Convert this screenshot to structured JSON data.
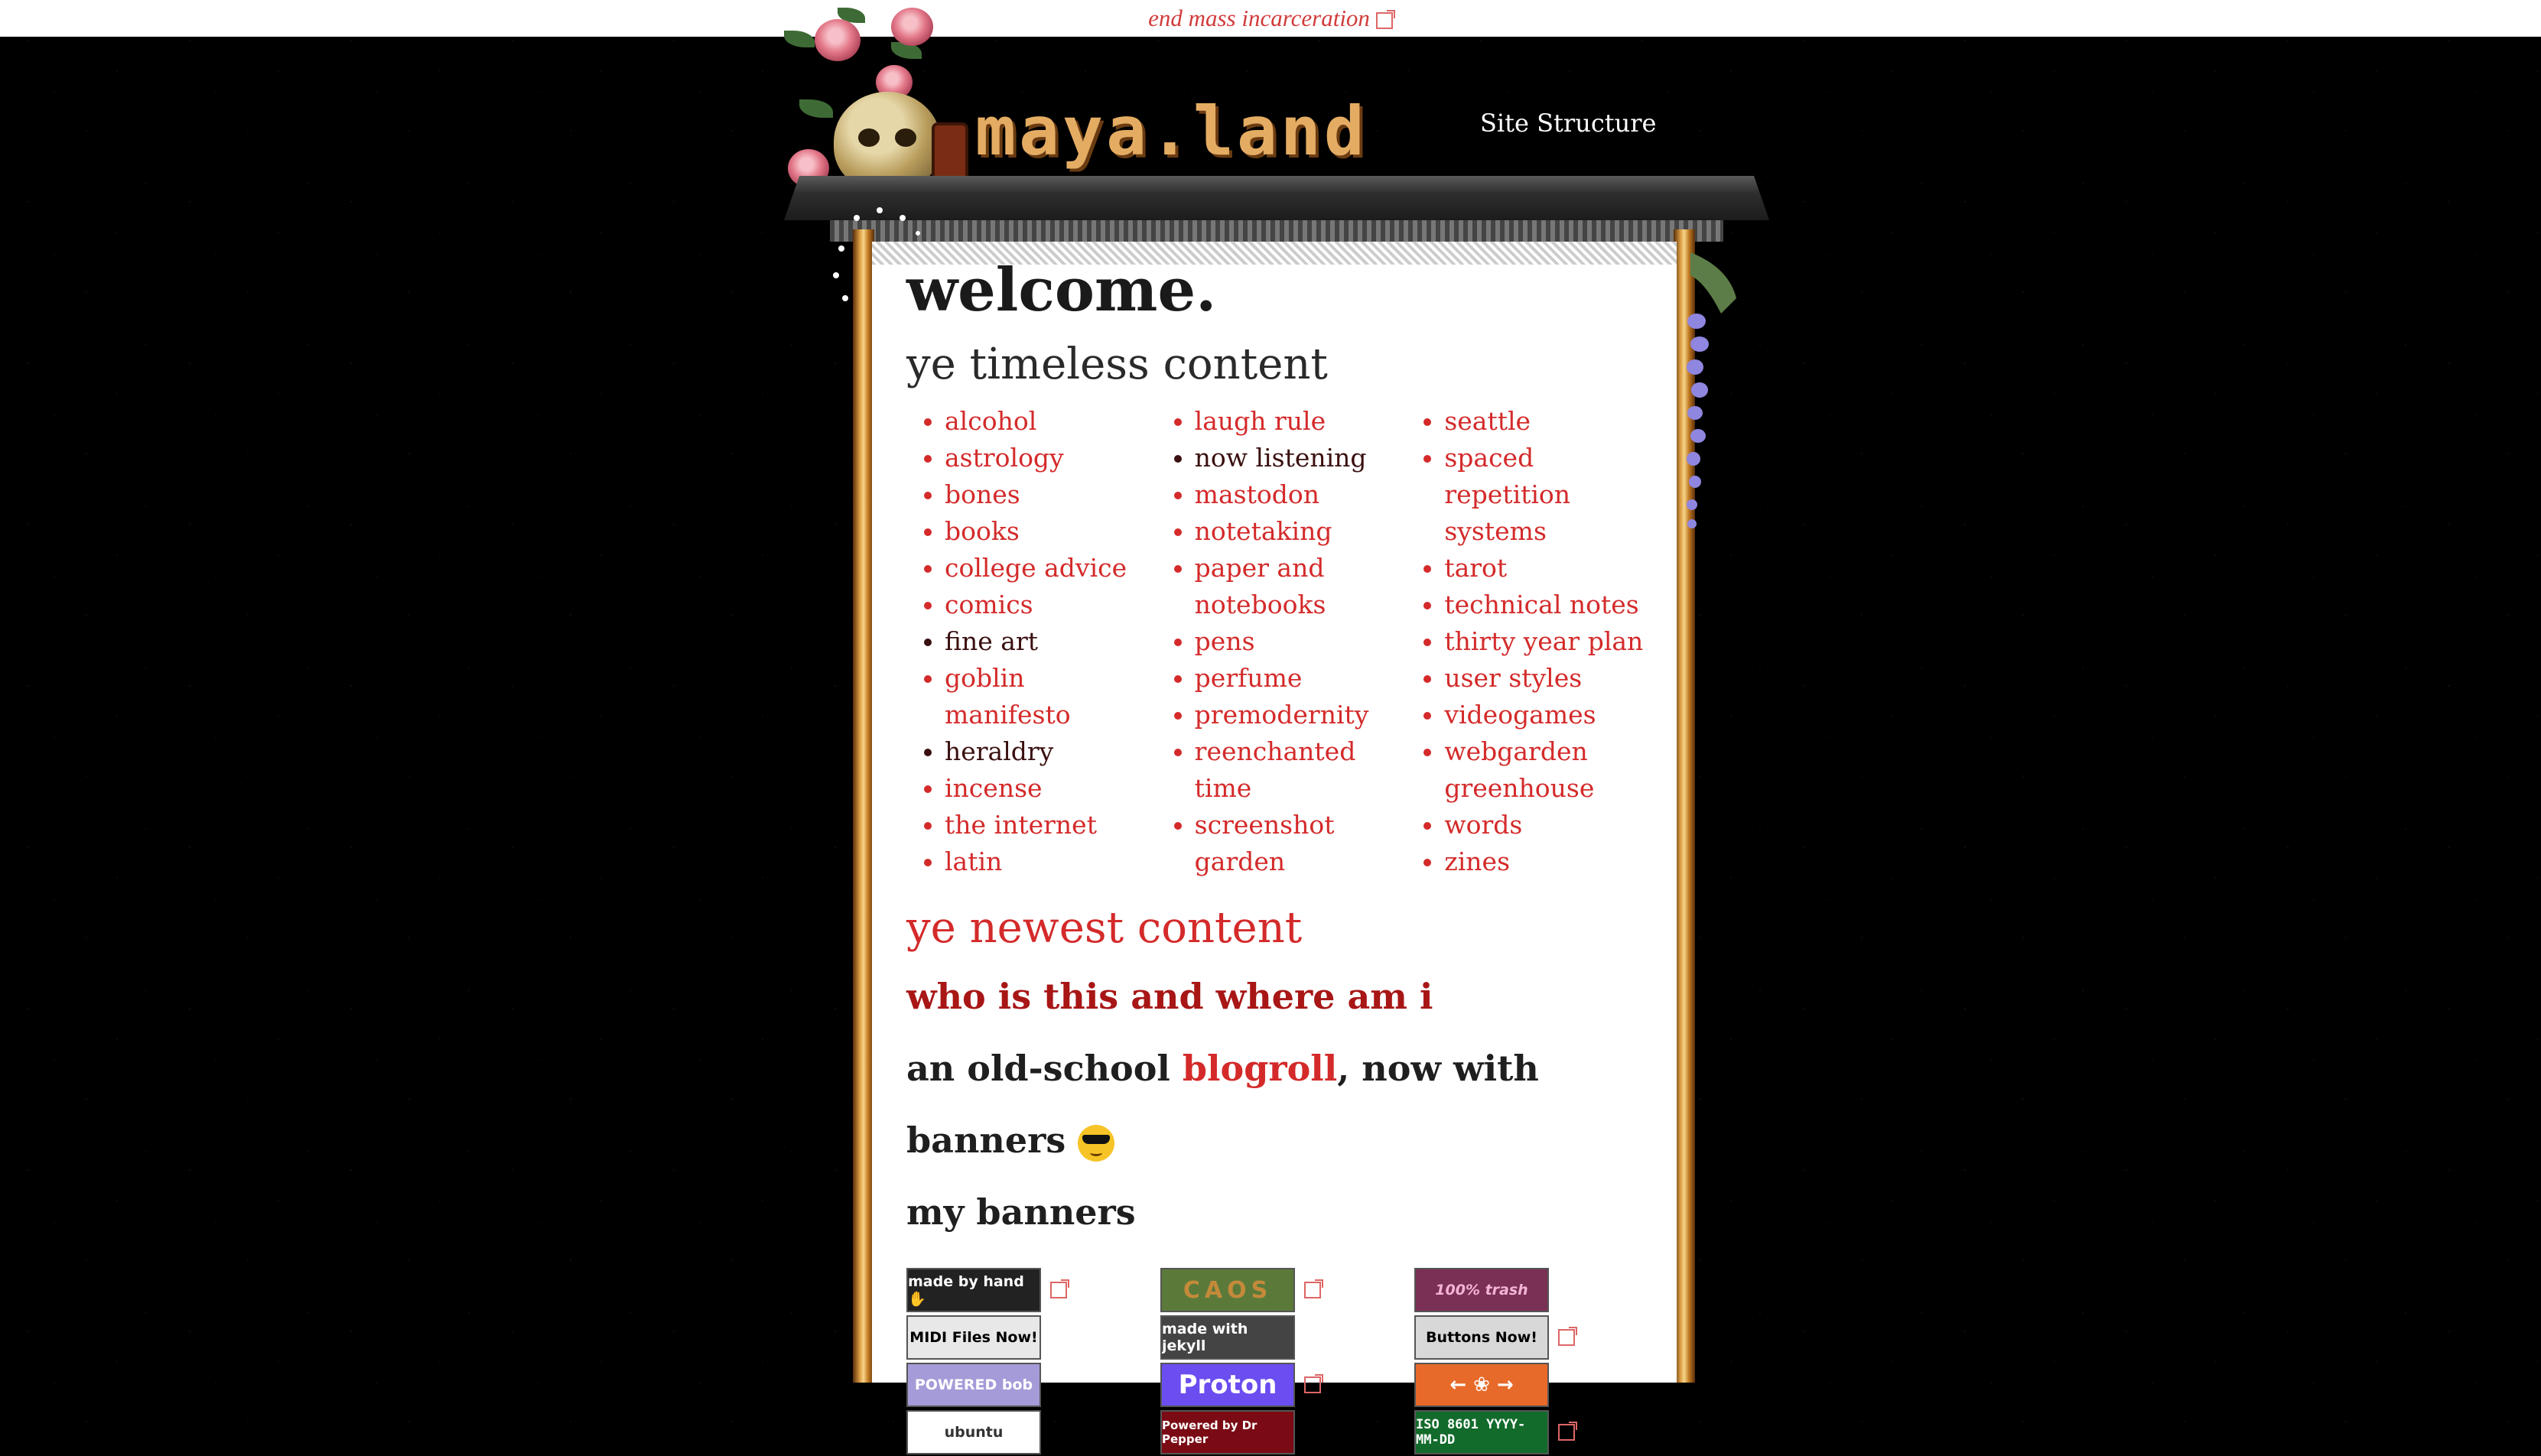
{
  "topbar": {
    "link": "end mass incarceration"
  },
  "header": {
    "logo": "maya.land",
    "nav": "Site Structure"
  },
  "main": {
    "title": "welcome.",
    "timeless_heading": "ye timeless content",
    "columns": [
      [
        "alcohol",
        "astrology",
        "bones",
        "books",
        "college advice",
        "comics",
        "fine art",
        "goblin manifesto",
        "heraldry",
        "incense",
        "the internet",
        "latin"
      ],
      [
        "laugh rule",
        "now listening",
        "mastodon",
        "notetaking",
        "paper and notebooks",
        "pens",
        "perfume",
        "premodernity",
        "reenchanted time",
        "screenshot garden"
      ],
      [
        "seattle",
        "spaced repetition systems",
        "tarot",
        "technical notes",
        "thirty year plan",
        "user styles",
        "videogames",
        "webgarden",
        "greenhouse",
        "words",
        "zines"
      ]
    ],
    "newest_heading": "ye newest content",
    "who": "who is this and where am i",
    "blogroll_pre": "an old-school ",
    "blogroll_link": "blogroll",
    "blogroll_post": ", now with banners",
    "banners_heading": "my banners",
    "banners": [
      [
        {
          "text": "made by hand ✋",
          "bg": "#222",
          "fg": "#fff"
        },
        {
          "text": "MIDI Files Now!",
          "bg": "#e8e8e8",
          "fg": "#000"
        },
        {
          "text": "POWERED bob",
          "bg": "#a59bd8",
          "fg": "#fff"
        },
        {
          "text": "ubuntu",
          "bg": "#fff",
          "fg": "#333"
        }
      ],
      [
        {
          "text": "CAOS",
          "bg": "#5b7a3a",
          "fg": "#c48a3a"
        },
        {
          "text": "made with jekyll",
          "bg": "#444",
          "fg": "#fff"
        },
        {
          "text": "Proton",
          "bg": "#6b4df0",
          "fg": "#fff"
        },
        {
          "text": "Powered by Dr Pepper",
          "bg": "#7a0b14",
          "fg": "#fff"
        }
      ],
      [
        {
          "text": "100% trash",
          "bg": "#7a2f55",
          "fg": "#f3b4d2"
        },
        {
          "text": "Buttons Now!",
          "bg": "#d8d8d8",
          "fg": "#000"
        },
        {
          "text": "← ❀ →",
          "bg": "#e86a2a",
          "fg": "#fff"
        },
        {
          "text": "ISO 8601 YYYY-MM-DD",
          "bg": "#136b2b",
          "fg": "#ffffff"
        }
      ]
    ]
  },
  "colors": {
    "accent": "#d42a2a",
    "logo": "#e4ac63"
  }
}
